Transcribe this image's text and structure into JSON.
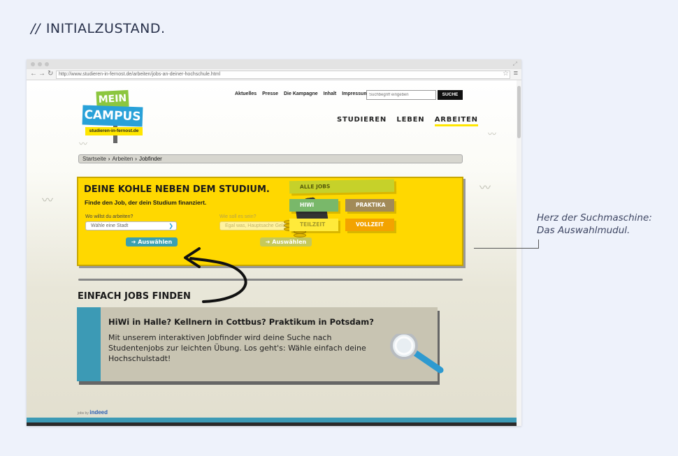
{
  "heading": {
    "slashes": "//",
    "text": "INITIALZUSTAND."
  },
  "browser": {
    "url": "http://www.studieren-in-fernost.de/arbeiten/jobs-an-deiner-hochschule.html"
  },
  "logo": {
    "line1": "MEIN",
    "line2": "CAMPUS",
    "domain": "studieren-in-fernost.de"
  },
  "topnav": [
    "Aktuelles",
    "Presse",
    "Die Kampagne",
    "Inhalt",
    "Impressum"
  ],
  "search": {
    "placeholder": "Suchbegriff eingeben",
    "button": "SUCHE"
  },
  "mainnav": [
    "STUDIEREN",
    "LEBEN",
    "ARBEITEN"
  ],
  "breadcrumb": [
    "Startseite",
    "Arbeiten",
    "Jobfinder"
  ],
  "module": {
    "title": "DEINE KOHLE NEBEN DEM STUDIUM.",
    "subtitle": "Finde den Job, der dein Studium finanziert.",
    "where_label": "Wo willst du arbeiten?",
    "where_value": "Wähle eine Stadt",
    "what_label": "Wie soll es sein?",
    "what_value": "Egal was, Hauptsache Geld",
    "button": "➔ Auswählen"
  },
  "job_types": [
    "ALLE JOBS",
    "HIWI",
    "PRAKTIKA",
    "TEILZEIT",
    "VOLLZEIT"
  ],
  "section": {
    "title": "EINFACH JOBS FINDEN",
    "teaser_title": "HiWi in Halle? Kellnern in Cottbus? Praktikum in Potsdam?",
    "teaser_body": "Mit unserem interaktiven Jobfinder wird deine Suche nach Studentenjobs zur leichten Übung. Los geht's: Wähle einfach deine Hochschulstadt!"
  },
  "footer": {
    "jobs_by": "jobs by",
    "brand": "indeed"
  },
  "annotation": {
    "line1": "Herz der Suchmaschine:",
    "line2": "Das Auswahlmudul."
  },
  "colors": {
    "yellow": "#ffd800",
    "blue": "#29a1d8",
    "green": "#8cc63f",
    "teal": "#3aa0b1"
  }
}
